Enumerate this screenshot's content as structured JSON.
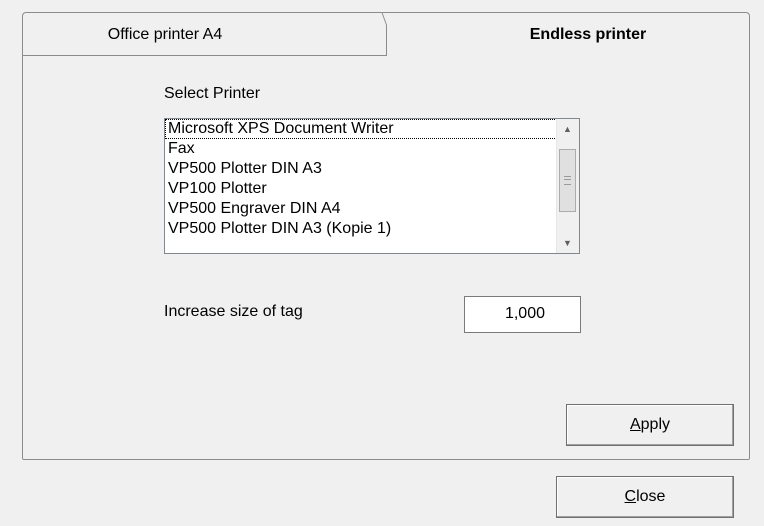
{
  "tabs": [
    {
      "label": "Office printer A4",
      "active": false
    },
    {
      "label": "Endless printer",
      "active": true
    }
  ],
  "printer_section": {
    "label": "Select Printer",
    "printers": [
      "Microsoft XPS Document Writer",
      "Fax",
      "VP500 Plotter DIN A3",
      "VP100 Plotter",
      "VP500 Engraver DIN A4",
      "VP500 Plotter DIN A3 (Kopie 1)"
    ],
    "selected_index": 0
  },
  "tag_size": {
    "label": "Increase size of tag",
    "value": "1,000"
  },
  "buttons": {
    "apply_access_key": "A",
    "apply_rest": "pply",
    "close_access_key": "C",
    "close_rest": "lose"
  },
  "icons": {
    "scroll_up": "triangle-up-icon",
    "scroll_down": "triangle-down-icon",
    "scroll_grip": "grip-icon"
  }
}
